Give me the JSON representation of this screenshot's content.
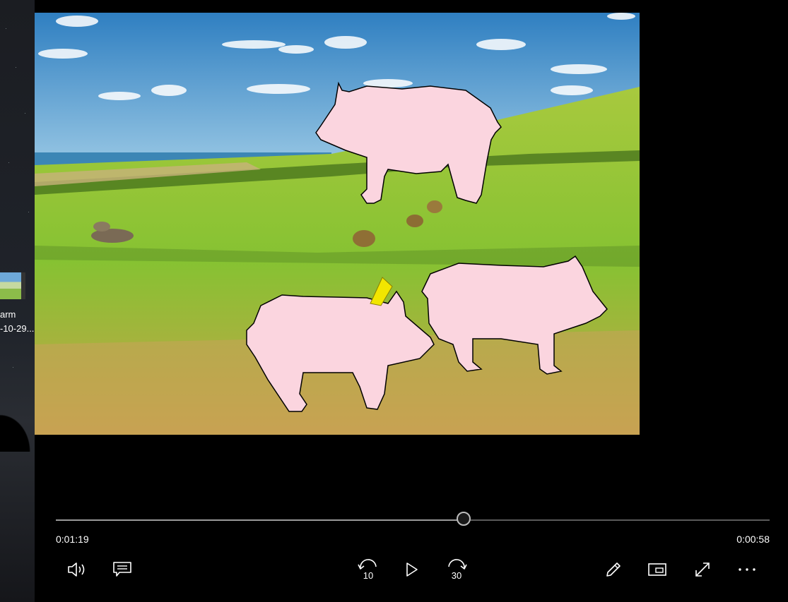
{
  "desktop": {
    "icon_label_line1": "arm",
    "icon_label_line2": "-10-29..."
  },
  "player": {
    "elapsed": "0:01:19",
    "remaining": "0:00:58",
    "progress": 0.571
  },
  "controls": {
    "volume": "volume-icon",
    "captions": "captions-icon",
    "skip_back": "skip-back-10-icon",
    "skip_back_text": "10",
    "play": "play-icon",
    "skip_forward": "skip-forward-30-icon",
    "skip_forward_text": "30",
    "edit": "pencil-icon",
    "mini_view": "mini-view-icon",
    "fullscreen": "fullscreen-icon",
    "more": "more-icon"
  },
  "colors": {
    "pig_fill": "#fbd5df",
    "accent_tag": "#f2e600",
    "sky": "#4a90c8",
    "grass": "#7cb342"
  }
}
